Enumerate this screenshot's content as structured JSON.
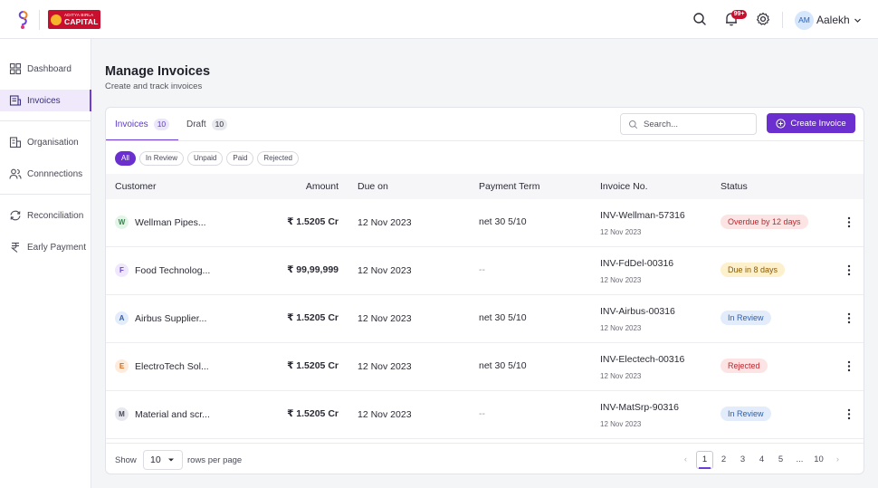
{
  "topbar": {
    "brand_line1": "ADITYA BIRLA",
    "brand_line2": "CAPITAL",
    "notification_count": "99+",
    "user_initials": "AM",
    "user_name": "Aalekh",
    "icons": [
      "search-icon",
      "bell-icon",
      "gear-icon",
      "chevron-down-icon"
    ]
  },
  "sidebar": {
    "items": [
      {
        "label": "Dashboard",
        "icon": "grid-icon"
      },
      {
        "label": "Invoices",
        "icon": "invoice-icon",
        "active": true
      },
      {
        "label": "Organisation",
        "icon": "building-icon"
      },
      {
        "label": "Connnections",
        "icon": "users-icon"
      },
      {
        "label": "Reconciliation",
        "icon": "refresh-icon"
      },
      {
        "label": "Early Payment",
        "icon": "rupee-icon"
      }
    ]
  },
  "header": {
    "title": "Manage Invoices",
    "subtitle": "Create and track invoices"
  },
  "tabs": [
    {
      "label": "Invoices",
      "count": "10",
      "active": true
    },
    {
      "label": "Draft",
      "count": "10",
      "active": false
    }
  ],
  "search": {
    "placeholder": "Search..."
  },
  "create_button": {
    "label": "Create Invoice"
  },
  "filters": [
    "All",
    "In Review",
    "Unpaid",
    "Paid",
    "Rejected"
  ],
  "table": {
    "columns": [
      "Customer",
      "Amount",
      "Due on",
      "Payment Term",
      "Invoice No.",
      "Status"
    ],
    "rows": [
      {
        "initial": "W",
        "initial_bg": "#e3f5e6",
        "initial_color": "#2e8a47",
        "customer": "Wellman Pipes...",
        "amount": "₹ 1.5205 Cr",
        "due": "12 Nov 2023",
        "term": "net 30 5/10",
        "invoice_no": "INV-Wellman-57316",
        "invoice_date": "12 Nov 2023",
        "status": "Overdue by 12 days",
        "status_bg": "#fde4e4",
        "status_color": "#c0262d"
      },
      {
        "initial": "F",
        "initial_bg": "#efe7fb",
        "initial_color": "#6b3fd6",
        "customer": "Food Technolog...",
        "amount": "₹ 99,99,999",
        "due": "12 Nov 2023",
        "term": "--",
        "invoice_no": "INV-FdDel-00316",
        "invoice_date": "12 Nov 2023",
        "status": "Due in 8 days",
        "status_bg": "#fdf0cc",
        "status_color": "#8a5a00"
      },
      {
        "initial": "A",
        "initial_bg": "#e2ecfb",
        "initial_color": "#2c5fb0",
        "customer": "Airbus Supplier...",
        "amount": "₹ 1.5205 Cr",
        "due": "12 Nov 2023",
        "term": "net 30 5/10",
        "invoice_no": "INV-Airbus-00316",
        "invoice_date": "12 Nov 2023",
        "status": "In Review",
        "status_bg": "#e2ecfb",
        "status_color": "#2c5fb0"
      },
      {
        "initial": "E",
        "initial_bg": "#fdebdc",
        "initial_color": "#d2691e",
        "customer": "ElectroTech Sol...",
        "amount": "₹ 1.5205 Cr",
        "due": "12 Nov 2023",
        "term": "net 30 5/10",
        "invoice_no": "INV-Electech-00316",
        "invoice_date": "12 Nov 2023",
        "status": "Rejected",
        "status_bg": "#fde4e4",
        "status_color": "#c0262d"
      },
      {
        "initial": "M",
        "initial_bg": "#e8e9ee",
        "initial_color": "#4a4a58",
        "customer": "Material and scr...",
        "amount": "₹ 1.5205 Cr",
        "due": "12 Nov 2023",
        "term": "--",
        "invoice_no": "INV-MatSrp-90316",
        "invoice_date": "12 Nov 2023",
        "status": "In Review",
        "status_bg": "#e2ecfb",
        "status_color": "#2c5fb0"
      }
    ]
  },
  "footer": {
    "show_label": "Show",
    "rows_per_page": "10",
    "rows_label": "rows per page",
    "pages": [
      "1",
      "2",
      "3",
      "4",
      "5",
      "...",
      "10"
    ],
    "current_page": "1"
  },
  "colors": {
    "accent": "#6b2fd0",
    "brand_red": "#c8102e"
  }
}
